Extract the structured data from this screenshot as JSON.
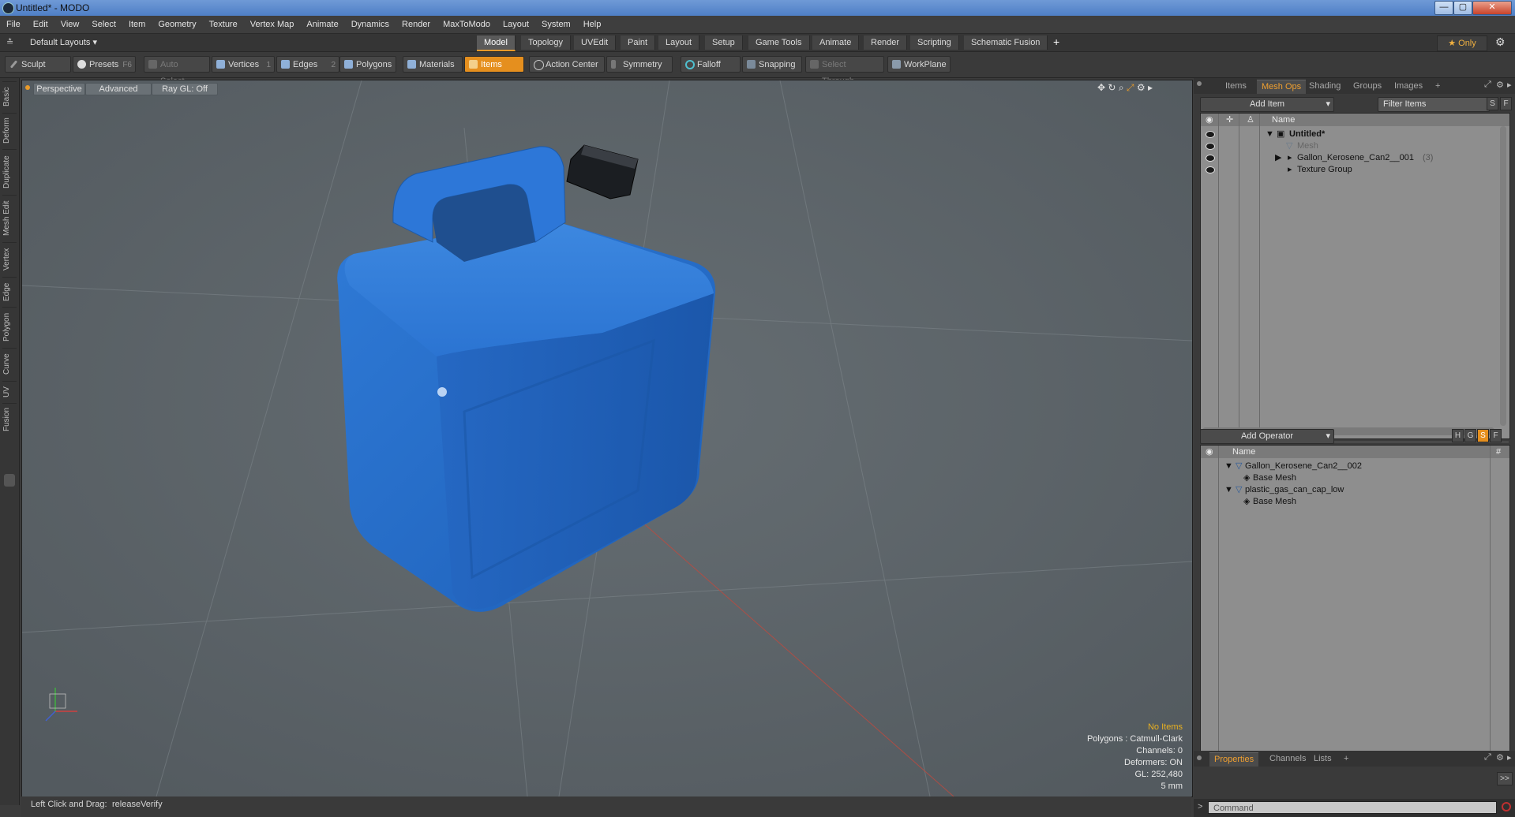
{
  "window": {
    "title": "Untitled* - MODO",
    "minimize": "—",
    "maximize": "▢",
    "close": "✕"
  },
  "menu": [
    "File",
    "Edit",
    "View",
    "Select",
    "Item",
    "Geometry",
    "Texture",
    "Vertex Map",
    "Animate",
    "Dynamics",
    "Render",
    "MaxToModo",
    "Layout",
    "System",
    "Help"
  ],
  "layout_bar": {
    "layout_menu": "Default Layouts ▾",
    "tabs": [
      "Model",
      "Topology",
      "UVEdit",
      "Paint",
      "Layout",
      "Setup",
      "Game Tools",
      "Animate",
      "Render",
      "Scripting",
      "Schematic Fusion"
    ],
    "active_tab": "Model",
    "add": "+",
    "only_label": "★ Only",
    "gear": "⚙"
  },
  "toolbar": {
    "sculpt": "Sculpt",
    "presets": "Presets",
    "presets_key": "F6",
    "auto_select": "Auto Select",
    "vertices": "Vertices",
    "vertices_key": "1",
    "edges": "Edges",
    "edges_key": "2",
    "polygons": "Polygons",
    "materials": "Materials",
    "items": "Items",
    "action_center": "Action Center",
    "symmetry": "Symmetry",
    "falloff": "Falloff",
    "snapping": "Snapping",
    "select_through": "Select Through",
    "workplane": "WorkPlane"
  },
  "left_tabs": [
    "Basic",
    "Deform",
    "Duplicate",
    "Mesh Edit",
    "Vertex",
    "Edge",
    "Polygon",
    "Curve",
    "UV",
    "Fusion"
  ],
  "viewport": {
    "perspective": "Perspective",
    "advanced": "Advanced",
    "raygl": "Ray GL: Off",
    "stats": {
      "no_items": "No Items",
      "polygons": "Polygons : Catmull-Clark",
      "channels": "Channels: 0",
      "deformers": "Deformers: ON",
      "gl": "GL: 252,480",
      "unit": "5 mm"
    }
  },
  "status": {
    "hint_label": "Left Click and Drag:",
    "hint_value": "releaseVerify"
  },
  "items_panel": {
    "tabs": [
      "Items",
      "Mesh Ops",
      "Shading",
      "Groups",
      "Images",
      "+"
    ],
    "active_tab": "Mesh Ops",
    "add_item": "Add Item",
    "filter": "Filter Items",
    "s": "S",
    "f": "F",
    "col_name": "Name",
    "rows": [
      {
        "label": "Untitled*",
        "bold": true
      },
      {
        "label": "Mesh",
        "dim": true
      },
      {
        "label": "Gallon_Kerosene_Can2__001",
        "count": "(3)"
      },
      {
        "label": "Texture Group"
      }
    ]
  },
  "meshops_panel": {
    "add_operator": "Add Operator",
    "h": "H",
    "g": "G",
    "s": "S",
    "f": "F",
    "col_name": "Name",
    "col_hash": "#",
    "rows": [
      {
        "label": "Gallon_Kerosene_Can2__002",
        "indent": 0
      },
      {
        "label": "Base Mesh",
        "indent": 1
      },
      {
        "label": "plastic_gas_can_cap_low",
        "indent": 0
      },
      {
        "label": "Base Mesh",
        "indent": 1
      }
    ]
  },
  "props_panel": {
    "tabs": [
      "Properties",
      "Channels",
      "Lists",
      "+"
    ],
    "active_tab": "Properties",
    "expand": ">>"
  },
  "command": {
    "placeholder": "Command",
    "prompt": ">"
  },
  "colors": {
    "accent": "#e58f1e",
    "can_blue": "#2a6fd0",
    "viewport_bg": "#5b6368"
  }
}
